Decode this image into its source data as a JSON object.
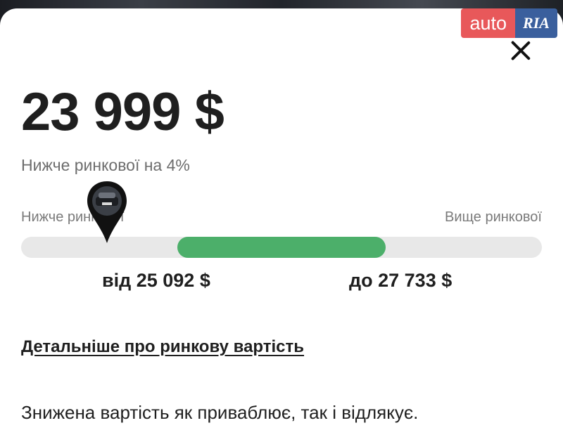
{
  "brand": {
    "auto": "auto",
    "ria": "RIA",
    "auto_color": "#e8585a",
    "ria_color": "#3a5f9d"
  },
  "close_icon": "close-icon",
  "price": "23 999 $",
  "market_note": "Нижче ринкової на 4%",
  "scale": {
    "low_label": "Нижче ринкової",
    "high_label": "Вище ринкової",
    "range_start": 0.3,
    "range_end": 0.7,
    "marker_position": 0.165,
    "range_color": "#4caf6a",
    "track_color": "#e8e8e8"
  },
  "range_from": "від 25 092 $",
  "range_to": "до 27 733 $",
  "details_link": "Детальніше про ринкову вартість",
  "body_text": "Знижена вартість як приваблює, так і відлякує."
}
